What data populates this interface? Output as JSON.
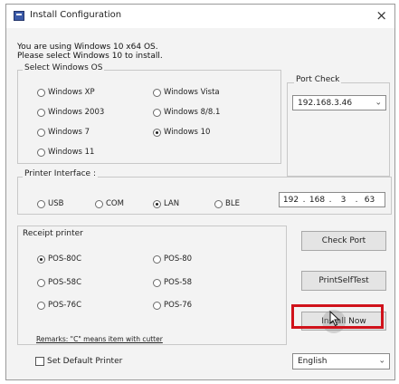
{
  "window": {
    "title": "Install Configuration",
    "close_glyph": "×"
  },
  "header_lines": [
    "You are using Windows 10 x64 OS.",
    "Please select Windows 10 to install."
  ],
  "os_group": {
    "label": "Select Windows OS",
    "options": [
      {
        "label": "Windows XP",
        "selected": false
      },
      {
        "label": "Windows Vista",
        "selected": false
      },
      {
        "label": "Windows 2003",
        "selected": false
      },
      {
        "label": "Windows 8/8.1",
        "selected": false
      },
      {
        "label": "Windows 7",
        "selected": false
      },
      {
        "label": "Windows 10",
        "selected": true
      },
      {
        "label": "Windows 11",
        "selected": false
      }
    ]
  },
  "port_check": {
    "label": "Port Check",
    "value": "192.168.3.46"
  },
  "printer_interface": {
    "label": "Printer Interface :",
    "options": [
      {
        "label": "USB",
        "selected": false
      },
      {
        "label": "COM",
        "selected": false
      },
      {
        "label": "LAN",
        "selected": true
      },
      {
        "label": "BLE",
        "selected": false
      }
    ],
    "ip": [
      "192",
      "168",
      "3",
      "63"
    ]
  },
  "receipt_printer": {
    "label": "Receipt printer",
    "options": [
      {
        "label": "POS-80C",
        "selected": true
      },
      {
        "label": "POS-80",
        "selected": false
      },
      {
        "label": "POS-58C",
        "selected": false
      },
      {
        "label": "POS-58",
        "selected": false
      },
      {
        "label": "POS-76C",
        "selected": false
      },
      {
        "label": "POS-76",
        "selected": false
      }
    ],
    "remark": "Remarks: \"C\" means item with cutter"
  },
  "buttons": {
    "check_port": "Check Port",
    "print_self_test": "PrintSelfTest",
    "install_now": "Install Now"
  },
  "set_default": {
    "label": "Set Default Printer",
    "checked": false
  },
  "language": {
    "value": "English"
  },
  "icons": {
    "app": "app-window-icon",
    "dropdown": "chevron-down-icon",
    "pointer": "mouse-pointer-icon"
  },
  "colors": {
    "highlight": "#d0121b"
  }
}
